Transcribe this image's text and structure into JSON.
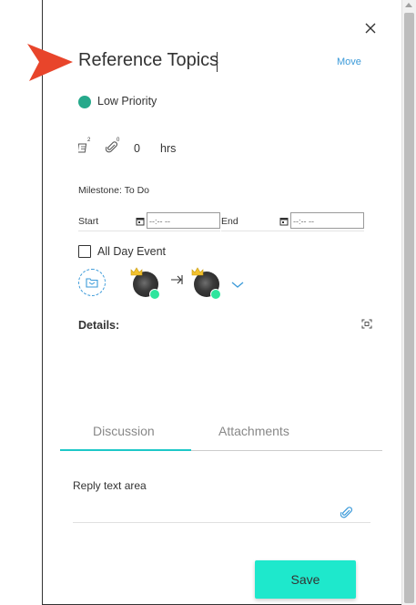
{
  "task": {
    "title": "Reference Topics",
    "move_label": "Move",
    "priority_label": "Low Priority",
    "priority_color": "#26a98b",
    "subtasks_count": "2",
    "attachments_count": "0",
    "hours_value": "0",
    "hours_unit": "hrs",
    "milestone": "Milestone: To Do",
    "start_label": "Start",
    "start_value": "--:-- --",
    "end_label": "End",
    "end_value": "--:-- --",
    "all_day_label": "All Day Event",
    "details_label": "Details:"
  },
  "tabs": {
    "discussion": "Discussion",
    "attachments": "Attachments",
    "active": "discussion",
    "active_color": "#1ec8c8"
  },
  "reply": {
    "placeholder": "Reply text area"
  },
  "actions": {
    "save_label": "Save",
    "save_color": "#1ee8cc"
  },
  "icons": {
    "close": "close-icon",
    "pointer": "pointer-arrow-icon",
    "subtasks": "subtasks-icon",
    "attachments": "paperclip-icon",
    "calendar": "calendar-icon",
    "folder": "folder-icon",
    "assign_arrow": "arrow-right-icon",
    "chevron": "chevron-down-icon",
    "expand": "expand-icon"
  }
}
